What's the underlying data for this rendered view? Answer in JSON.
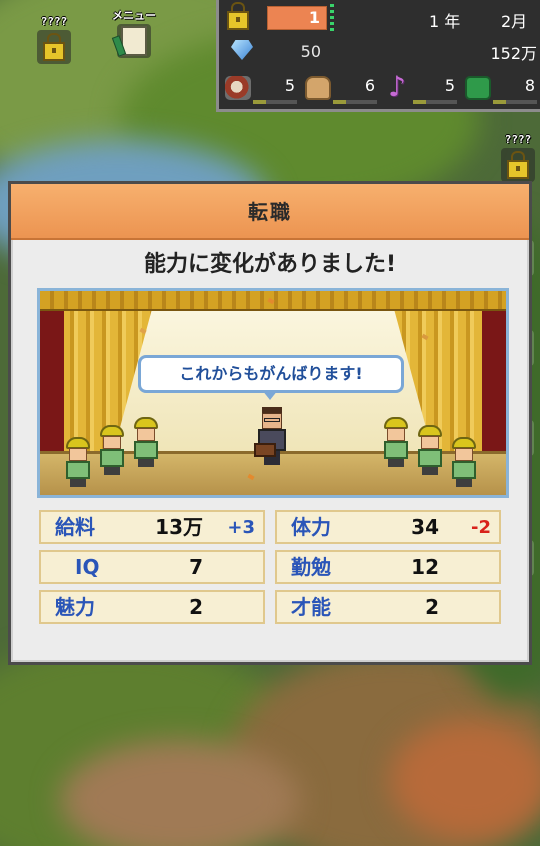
{
  "top_left": {
    "locked_label": "????",
    "menu_label": "メニュー"
  },
  "status": {
    "rank": "1",
    "year_label": "1 年",
    "month_label": "2月",
    "gems": "50",
    "money": "152万",
    "resources": [
      {
        "icon": "food-icon",
        "value": "5",
        "level": 0.3
      },
      {
        "icon": "bag-icon",
        "value": "6",
        "level": 0.3
      },
      {
        "icon": "music-note-icon",
        "value": "5",
        "level": 0.3
      },
      {
        "icon": "book-icon",
        "value": "8",
        "level": 0.3
      }
    ]
  },
  "side": {
    "locked_label": "????"
  },
  "dialog": {
    "title": "転職",
    "message": "能力に変化がありました!",
    "speech": "これからもがんばります!",
    "stats": [
      {
        "label": "給料",
        "value": "13万",
        "delta": "+3",
        "delta_dir": "up"
      },
      {
        "label": "体力",
        "value": "34",
        "delta": "-2",
        "delta_dir": "down"
      },
      {
        "label": "IQ",
        "value": "7",
        "delta": "",
        "delta_dir": ""
      },
      {
        "label": "勤勉",
        "value": "12",
        "delta": "",
        "delta_dir": ""
      },
      {
        "label": "魅力",
        "value": "2",
        "delta": "",
        "delta_dir": ""
      },
      {
        "label": "才能",
        "value": "2",
        "delta": "",
        "delta_dir": ""
      }
    ]
  },
  "colors": {
    "header_orange": "#ec9451",
    "stat_label_blue": "#2a55b8",
    "delta_up": "#2a55b8",
    "delta_down": "#d8221b"
  }
}
